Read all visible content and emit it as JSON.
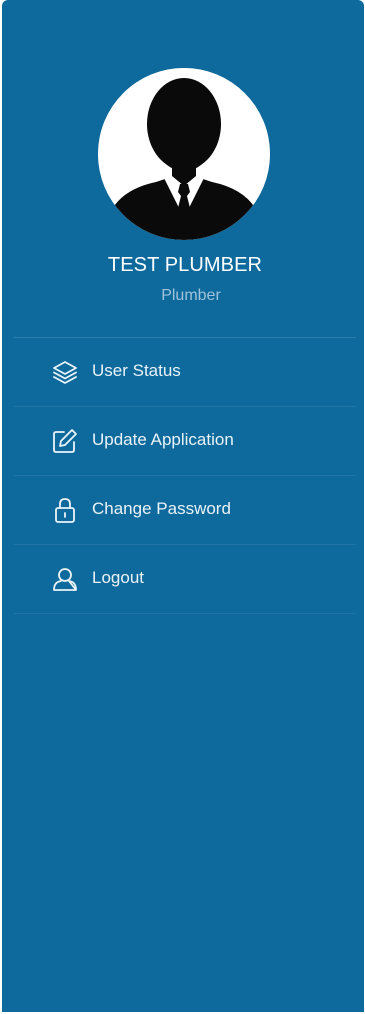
{
  "profile": {
    "name": "TEST PLUMBER",
    "role": "Plumber",
    "avatar_icon": "user-silhouette-avatar"
  },
  "menu": {
    "items": [
      {
        "label": "User Status",
        "icon": "layers-icon"
      },
      {
        "label": "Update Application",
        "icon": "edit-icon"
      },
      {
        "label": "Change Password",
        "icon": "lock-icon"
      },
      {
        "label": "Logout",
        "icon": "user-icon"
      }
    ]
  },
  "colors": {
    "sidebar_bg": "#0e6a9c",
    "role_text": "#9fc3da",
    "label_text": "#eaf3f9"
  }
}
